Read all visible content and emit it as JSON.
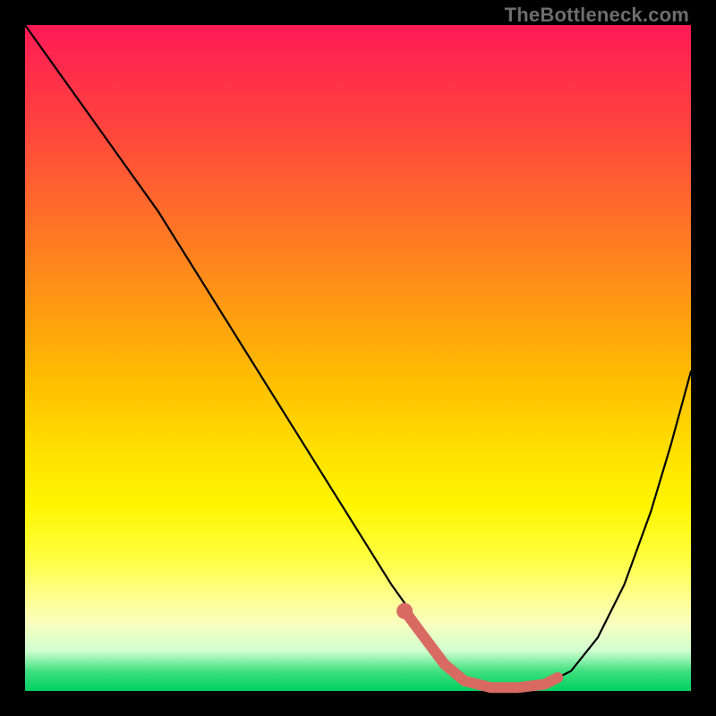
{
  "watermark": "TheBottleneck.com",
  "colors": {
    "accent": "#d86a63",
    "line": "#000000",
    "gradient_top": "#ff1a56",
    "gradient_bottom": "#00d060"
  },
  "chart_data": {
    "type": "line",
    "title": "",
    "xlabel": "",
    "ylabel": "",
    "xlim": [
      0,
      100
    ],
    "ylim": [
      0,
      100
    ],
    "series": [
      {
        "name": "bottleneck-curve",
        "x": [
          0,
          5,
          10,
          15,
          20,
          25,
          30,
          35,
          40,
          45,
          50,
          55,
          60,
          63,
          66,
          70,
          74,
          78,
          82,
          86,
          90,
          94,
          97,
          100
        ],
        "values": [
          100,
          93,
          86,
          79,
          72,
          64,
          56,
          48,
          40,
          32,
          24,
          16,
          9,
          4,
          1.5,
          0.5,
          0.5,
          1,
          3,
          8,
          16,
          27,
          37,
          48
        ]
      }
    ],
    "highlight": {
      "name": "accent-segment",
      "x": [
        57,
        60,
        63,
        66,
        70,
        74,
        78,
        80
      ],
      "values": [
        12,
        8,
        4,
        1.5,
        0.5,
        0.5,
        1,
        2
      ]
    },
    "highlight_dot": {
      "x": 57,
      "value": 12
    }
  }
}
